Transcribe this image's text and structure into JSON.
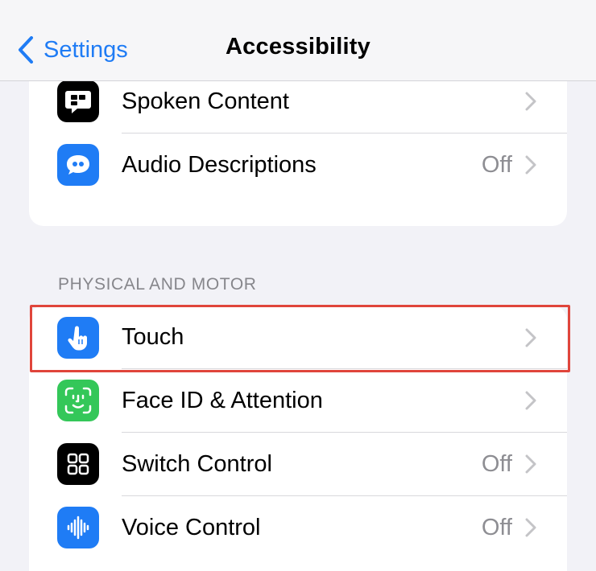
{
  "nav": {
    "back_label": "Settings",
    "title": "Accessibility"
  },
  "sections": {
    "physical_motor_header": "PHYSICAL AND MOTOR"
  },
  "rows": {
    "spoken_content": {
      "label": "Spoken Content",
      "icon": "speech-bubble-text-icon",
      "icon_color": "#000000"
    },
    "audio_descriptions": {
      "label": "Audio Descriptions",
      "value": "Off",
      "icon": "quote-bubble-icon",
      "icon_color": "#1f7cf5"
    },
    "touch": {
      "label": "Touch",
      "icon": "hand-pointer-icon",
      "icon_color": "#1f7cf5",
      "highlighted": true
    },
    "face_id": {
      "label": "Face ID & Attention",
      "icon": "face-id-icon",
      "icon_color": "#34c759"
    },
    "switch_control": {
      "label": "Switch Control",
      "value": "Off",
      "icon": "grid-squares-icon",
      "icon_color": "#000000"
    },
    "voice_control": {
      "label": "Voice Control",
      "value": "Off",
      "icon": "waveform-icon",
      "icon_color": "#1f7cf5"
    }
  },
  "colors": {
    "accent": "#1f7cf5",
    "highlight_border": "#e0453b",
    "background": "#f2f2f7"
  }
}
